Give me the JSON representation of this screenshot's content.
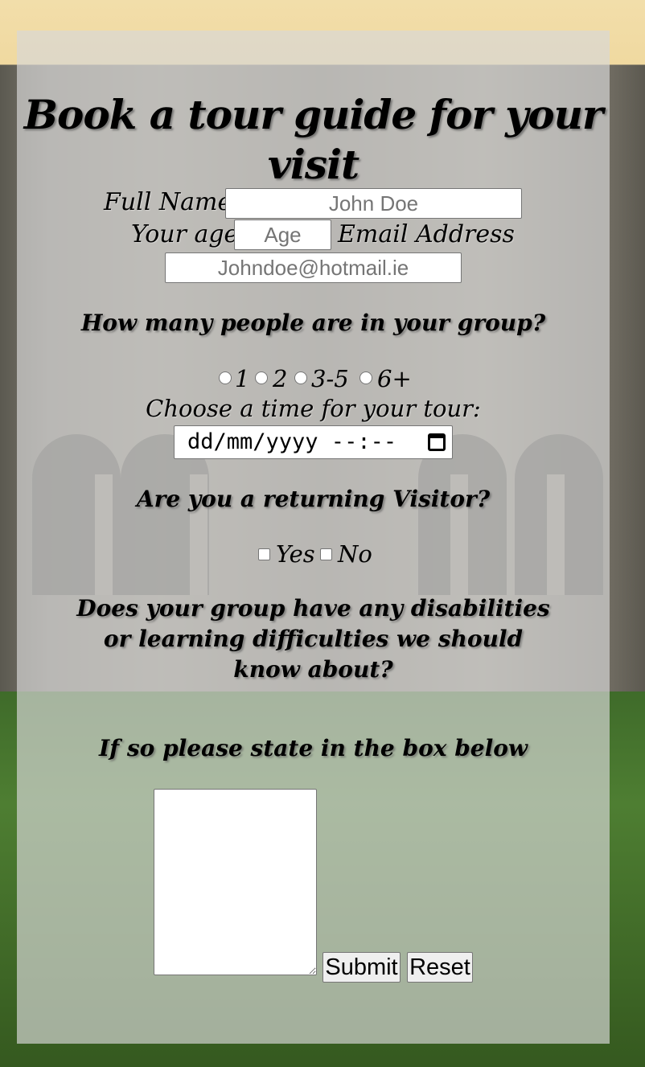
{
  "page": {
    "heading": "Book a tour guide for your visit",
    "heading_line1": "Book a tour guide for your",
    "heading_line2": "visit"
  },
  "form": {
    "full_name": {
      "label": "Full Name",
      "placeholder": "John Doe"
    },
    "age": {
      "label": "Your age",
      "placeholder": "Age"
    },
    "email": {
      "label": "Email Address",
      "placeholder": "Johndoe@hotmail.ie"
    },
    "group_size": {
      "question": "How many people are in your group?",
      "options": [
        "1",
        "2",
        "3-5",
        "6+"
      ]
    },
    "tour_time": {
      "label": "Choose a time for your tour:",
      "placeholder": "dd/mm/yyyy --:--",
      "icon": "calendar-icon"
    },
    "returning": {
      "question": "Are you a returning Visitor?",
      "options": [
        "Yes",
        "No"
      ]
    },
    "disabilities": {
      "question_lines": [
        "Does your group have any disabilities",
        "or learning difficulties we should",
        "know about?"
      ],
      "instruction": "If so please state in the box below",
      "value": ""
    },
    "buttons": {
      "submit": "Submit",
      "reset": "Reset"
    }
  },
  "colors": {
    "panel_overlay": "#d7d7d7",
    "sky": "#f2deaa",
    "grass": "#4e7e32",
    "stone": "#8a8578"
  }
}
